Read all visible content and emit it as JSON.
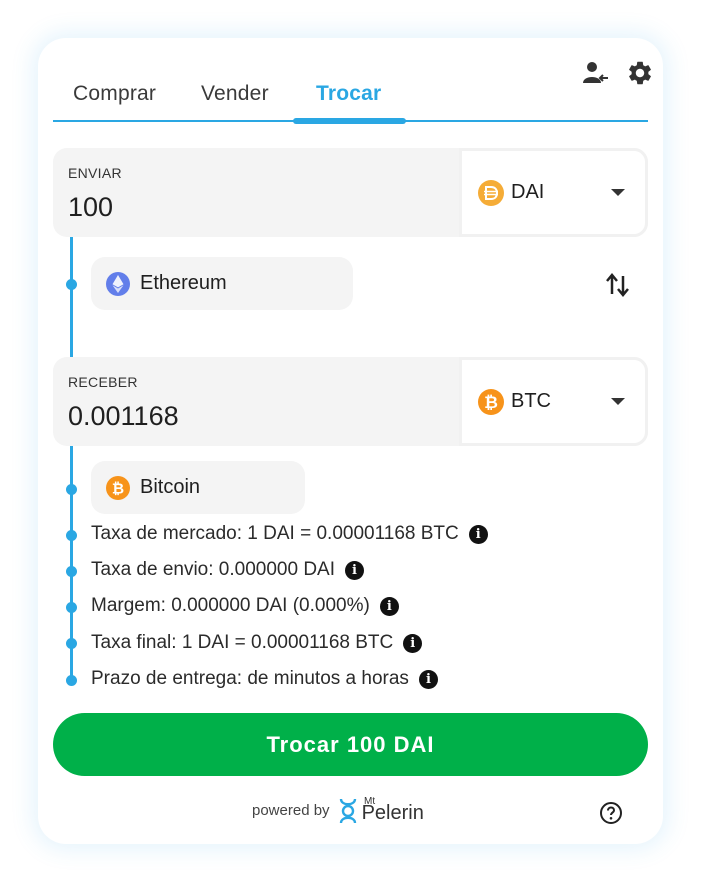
{
  "tabs": [
    {
      "label": "Comprar"
    },
    {
      "label": "Vender"
    },
    {
      "label": "Trocar"
    }
  ],
  "send": {
    "label": "ENVIAR",
    "amount": "100",
    "currency": "DAI",
    "network": "Ethereum"
  },
  "receive": {
    "label": "RECEBER",
    "amount": "0.001168",
    "currency": "BTC",
    "network": "Bitcoin"
  },
  "info": [
    "Taxa de mercado: 1 DAI = 0.00001168 BTC",
    "Taxa de envio: 0.000000 DAI",
    "Margem: 0.000000 DAI (0.000%)",
    "Taxa final: 1 DAI = 0.00001168 BTC",
    "Prazo de entrega: de minutos a horas"
  ],
  "info_icon": "i",
  "cta_label": "Trocar 100 DAI",
  "powered_by": "powered by",
  "brand": {
    "small": "Mt",
    "name": "Pelerin"
  },
  "colors": {
    "accent": "#2aa7e3",
    "cta": "#00b049",
    "dai": "#f5ac37",
    "btc": "#f7931a",
    "eth": "#627eea"
  }
}
